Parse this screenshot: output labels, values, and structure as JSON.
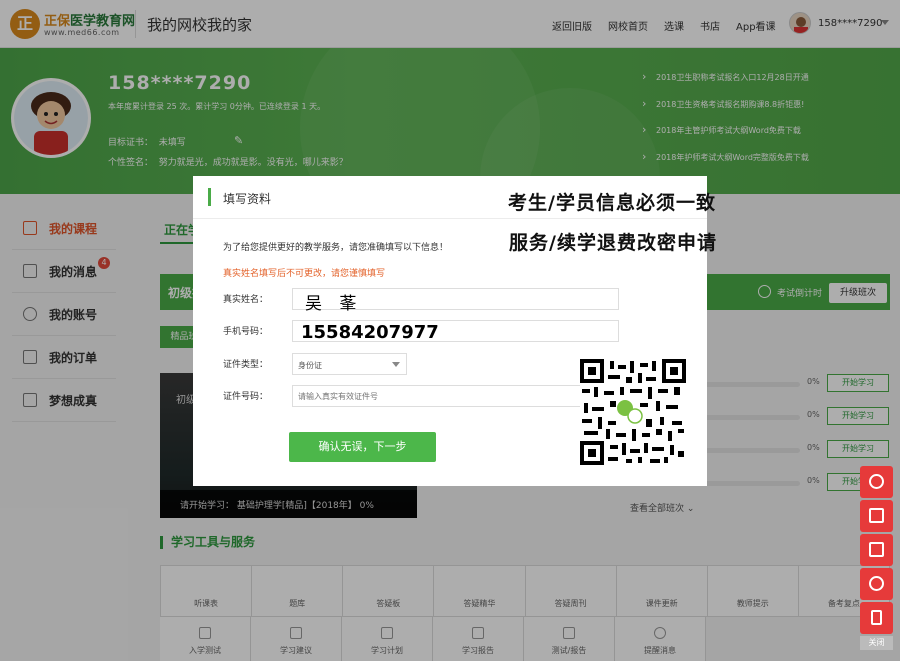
{
  "header": {
    "logo_char": "正",
    "logo_brand": "正保",
    "logo_name": "医学教育网",
    "logo_url": "www.med66.com",
    "site_title": "我的网校我的家",
    "nav": [
      "返回旧版",
      "网校首页",
      "选课",
      "书店",
      "App看课"
    ],
    "username": "158****7290"
  },
  "profile": {
    "phone": "158****7290",
    "stats": "本年度累计登录 25 次。累计学习 0分钟。已连续登录 1 天。",
    "cert_label": "目标证书：",
    "cert_value": "未填写",
    "sign_label": "个性签名：",
    "sign_value": "努力就是光，成功就是影。没有光，哪儿来影？"
  },
  "news": [
    "2018卫生职称考试报名入口12月28日开通",
    "2018卫生资格考试报名期购课8.8折钜惠!",
    "2018年主管护师考试大纲Word免费下载",
    "2018年护师考试大纲Word完整版免费下载"
  ],
  "sidebar": {
    "items": [
      {
        "label": "我的课程"
      },
      {
        "label": "我的消息"
      },
      {
        "label": "我的账号"
      },
      {
        "label": "我的订单"
      },
      {
        "label": "梦想成真"
      }
    ],
    "message_badge": "4"
  },
  "main": {
    "tab_active": "正在学习",
    "course_title": "初级护师",
    "countdown_label": "考试倒计时",
    "upgrade_label": "升级班次",
    "tag": "精品班",
    "video_top": "初级护师",
    "video_caption": "请开始学习：  基础护理学[精品]【2018年】  0%",
    "progress_rows": [
      {
        "pct": "0%",
        "action": "开始学习"
      },
      {
        "pct": "0%",
        "action": "开始学习"
      },
      {
        "pct": "0%",
        "action": "开始学习"
      },
      {
        "pct": "0%",
        "action": "开始学习"
      }
    ],
    "more_label": "查看全部班次",
    "tools_title": "学习工具与服务",
    "tools_row1": [
      "听课表",
      "题库",
      "答疑板",
      "答疑精华",
      "答疑周刊",
      "课件更新",
      "教师提示",
      "备考复点"
    ],
    "tools_row2": [
      "入学测试",
      "学习建议",
      "学习计划",
      "学习报告",
      "测试/报告",
      "提醒消息"
    ]
  },
  "modal": {
    "title": "填写资料",
    "warn1": "考生/学员信息必须一致",
    "warn2": "服务/续学退费改密申请",
    "intro": "为了给您提供更好的教学服务，请您准确填写以下信息！",
    "caution": "真实姓名填写后不可更改，请您谨慎填写",
    "name_label": "真实姓名：",
    "name_value": "吴 莑",
    "phone_label": "手机号码：",
    "phone_value": "15584207977",
    "idtype_label": "证件类型：",
    "idtype_value": "身份证",
    "idno_label": "证件号码：",
    "idno_placeholder": "请输入真实有效证件号",
    "confirm_label": "确认无误，下一步"
  },
  "rightbar": {
    "close_label": "关闭"
  },
  "colors": {
    "brand_green": "#4aab48",
    "accent_orange": "#e0552a",
    "side_red": "#e63a3a"
  }
}
